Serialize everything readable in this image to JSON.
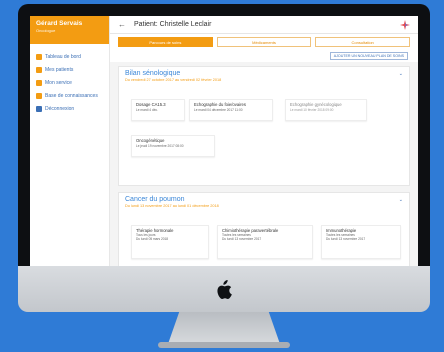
{
  "sidebar": {
    "user_name": "Gérard Servais",
    "user_role": "Oncologue",
    "items": [
      {
        "label": "Tableau de bord",
        "color": "#f39c12"
      },
      {
        "label": "Mes patients",
        "color": "#f39c12"
      },
      {
        "label": "Mon service",
        "color": "#f39c12"
      },
      {
        "label": "Base de connaissances",
        "color": "#f39c12"
      },
      {
        "label": "Déconnexion",
        "color": "#3b6fb5"
      }
    ]
  },
  "header": {
    "back_glyph": "←",
    "title": "Patient: Christelle Leclair"
  },
  "tabs": [
    {
      "label": "Parcours de soins",
      "active": true
    },
    {
      "label": "Médicaments",
      "active": false
    },
    {
      "label": "Consultation",
      "active": false
    }
  ],
  "add_plan_label": "AJOUTER UN NOUVEAU PLAN DE SOINS",
  "sections": [
    {
      "title": "Bilan sénologique",
      "subtitle": "Du vendredi 27 octobre 2017 au vendredi 02 février 2018",
      "exams": [
        {
          "name": "Dosage CA15.3",
          "date": "Le mardi 4 déc."
        },
        {
          "name": "Echographie du foie/ovaires",
          "date": "Le mardi 04 décembre 2017 11:00"
        },
        {
          "name": "Echographie gynécologique",
          "date": "Le mardi 10 février 2018 09:00"
        },
        {
          "name": "Oncogénétique",
          "date": "Le jeudi 19 novembre 2017 08:00"
        }
      ]
    },
    {
      "title": "Cancer du poumon",
      "subtitle": "Du lundi 13 novembre 2017 au lundi 01 décembre 2018",
      "exams": [
        {
          "name": "Thérapie hormonale",
          "line2": "Tous les jours",
          "line3": "Du lundi 05 mars 2018"
        },
        {
          "name": "Chimiothérapie paravertébrale",
          "line2": "Toutes les semaines",
          "line3": "Du lundi 13 novembre 2017"
        },
        {
          "name": "Immunothérapie",
          "line2": "Toutes les semaines",
          "line3": "Du lundi 13 novembre 2017"
        }
      ]
    }
  ]
}
